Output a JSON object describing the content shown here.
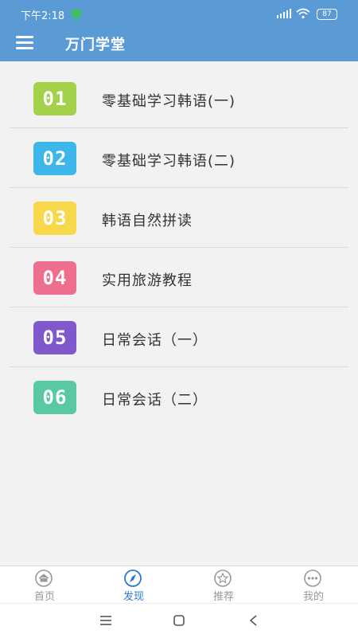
{
  "status": {
    "time": "下午2:18",
    "battery": "87"
  },
  "header": {
    "title": "万门学堂"
  },
  "courses": [
    {
      "num": "01",
      "label": "零基础学习韩语(一)",
      "color": "#a3d24a"
    },
    {
      "num": "02",
      "label": "零基础学习韩语(二)",
      "color": "#3db6ea"
    },
    {
      "num": "03",
      "label": "韩语自然拼读",
      "color": "#f7d84a"
    },
    {
      "num": "04",
      "label": "实用旅游教程",
      "color": "#ee6f8d"
    },
    {
      "num": "05",
      "label": "日常会话（一）",
      "color": "#7f59cc"
    },
    {
      "num": "06",
      "label": "日常会话（二）",
      "color": "#58c9a4"
    }
  ],
  "tabs": [
    {
      "label": "首页",
      "icon": "home-icon"
    },
    {
      "label": "发现",
      "icon": "compass-icon"
    },
    {
      "label": "推荐",
      "icon": "star-icon"
    },
    {
      "label": "我的",
      "icon": "more-icon"
    }
  ],
  "colors": {
    "primary": "#5b9bd5",
    "active": "#2a7ad1",
    "inactive": "#999999"
  }
}
